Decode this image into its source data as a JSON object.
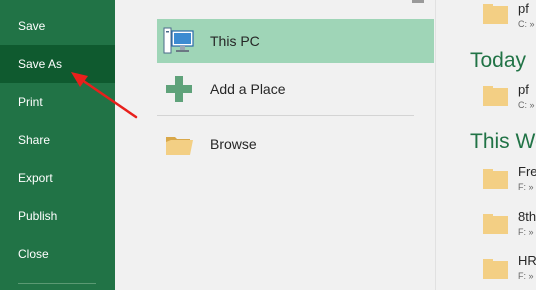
{
  "nav": {
    "items": [
      {
        "label": "Save"
      },
      {
        "label": "Save As",
        "selected": true
      },
      {
        "label": "Print"
      },
      {
        "label": "Share"
      },
      {
        "label": "Export"
      },
      {
        "label": "Publish"
      },
      {
        "label": "Close"
      }
    ]
  },
  "places": {
    "items": [
      {
        "label": "This PC",
        "icon": "computer-icon",
        "selected": true
      },
      {
        "label": "Add a Place",
        "icon": "plus-icon"
      },
      {
        "label": "Browse",
        "icon": "folder-icon"
      }
    ]
  },
  "recent": {
    "groups": [
      {
        "heading": "",
        "folders": [
          {
            "name": "pf",
            "path": "C: »"
          }
        ]
      },
      {
        "heading": "Today",
        "folders": [
          {
            "name": "pf",
            "path": "C: »"
          }
        ]
      },
      {
        "heading": "This We",
        "folders": [
          {
            "name": "Fre",
            "path": "F: »"
          },
          {
            "name": "8th",
            "path": "F: »"
          },
          {
            "name": "HR",
            "path": "F: »"
          }
        ]
      }
    ]
  },
  "colors": {
    "nav_bg": "#217346",
    "nav_selected": "#0f5a2f",
    "place_selected": "#9fd5b7",
    "accent_heading": "#217346",
    "annotation_arrow": "#e8201c"
  }
}
